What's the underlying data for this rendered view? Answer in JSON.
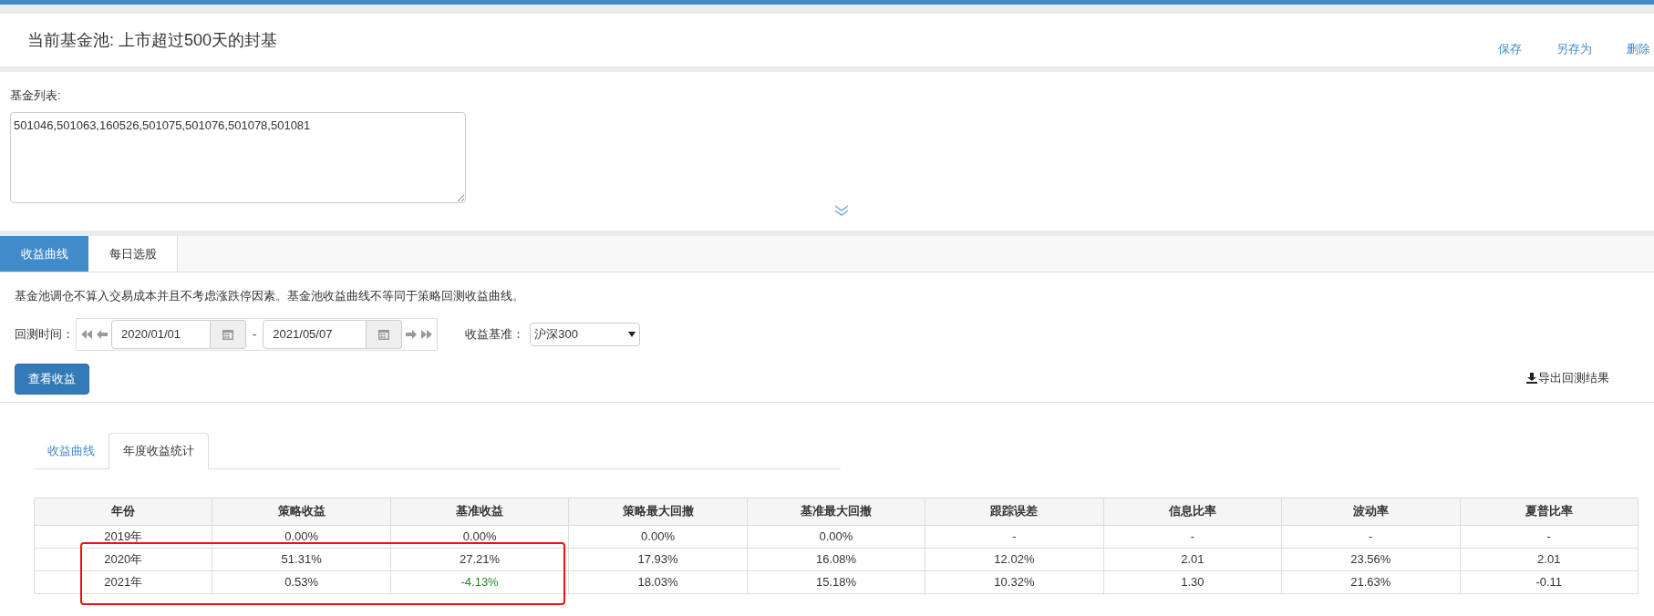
{
  "header": {
    "title": "当前基金池: 上市超过500天的封基",
    "actions": [
      "保存",
      "另存为",
      "删除"
    ]
  },
  "fund_list": {
    "label": "基金列表:",
    "value": "501046,501063,160526,501075,501076,501078,501081"
  },
  "tabs": [
    {
      "label": "收益曲线",
      "selected": true
    },
    {
      "label": "每日选股",
      "selected": false
    }
  ],
  "note": "基金池调仓不算入交易成本并且不考虑涨跌停因素。基金池收益曲线不等同于策略回测收益曲线。",
  "backtest": {
    "label": "回测时间：",
    "start": "2020/01/01",
    "separator": "-",
    "end": "2021/05/07"
  },
  "benchmark": {
    "label": "收益基准：",
    "value": "沪深300"
  },
  "view_button": "查看收益",
  "export_link": "导出回测结果",
  "sub_tabs": [
    {
      "label": "收益曲线",
      "selected": false
    },
    {
      "label": "年度收益统计",
      "selected": true
    }
  ],
  "table": {
    "columns": [
      "年份",
      "策略收益",
      "基准收益",
      "策略最大回撤",
      "基准最大回撤",
      "跟踪误差",
      "信息比率",
      "波动率",
      "夏普比率"
    ],
    "rows": [
      {
        "cells": [
          "2019年",
          "0.00%",
          "0.00%",
          "0.00%",
          "0.00%",
          "-",
          "-",
          "-",
          "-"
        ]
      },
      {
        "cells": [
          "2020年",
          "51.31%",
          "27.21%",
          "17.93%",
          "16.08%",
          "12.02%",
          "2.01",
          "23.56%",
          "2.01"
        ]
      },
      {
        "cells": [
          "2021年",
          "0.53%",
          {
            "text": "-4.13%",
            "color": "#1f8a1f"
          },
          "18.03%",
          "15.18%",
          "10.32%",
          "1.30",
          "21.63%",
          "-0.11"
        ]
      }
    ]
  }
}
